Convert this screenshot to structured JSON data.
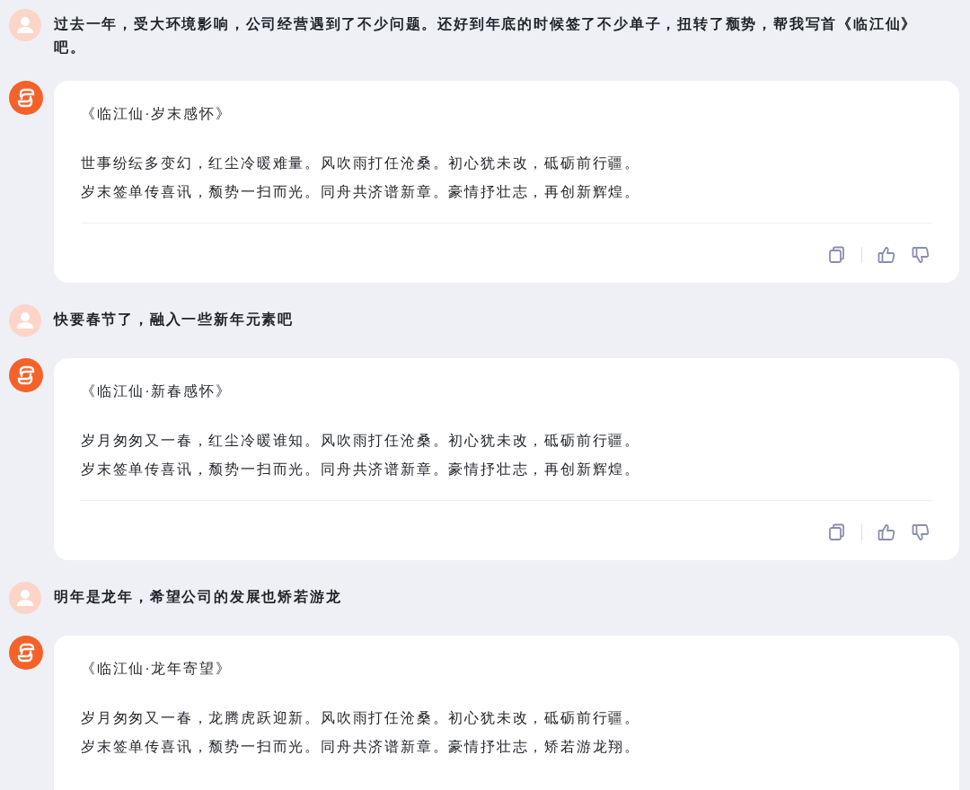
{
  "messages": [
    {
      "kind": "user",
      "text": "过去一年，受大环境影响，公司经营遇到了不少问题。还好到年底的时候签了不少单子，扭转了颓势，帮我写首《临江仙》吧。"
    },
    {
      "kind": "bot",
      "title": "《临江仙·岁末感怀》",
      "lines": [
        "世事纷纭多变幻，红尘冷暖难量。风吹雨打任沧桑。初心犹未改，砥砺前行疆。",
        "岁末签单传喜讯，颓势一扫而光。同舟共济谱新章。豪情抒壮志，再创新辉煌。"
      ],
      "actions": true
    },
    {
      "kind": "user",
      "text": "快要春节了，融入一些新年元素吧"
    },
    {
      "kind": "bot",
      "title": "《临江仙·新春感怀》",
      "lines": [
        "岁月匆匆又一春，红尘冷暖谁知。风吹雨打任沧桑。初心犹未改，砥砺前行疆。",
        "岁末签单传喜讯，颓势一扫而光。同舟共济谱新章。豪情抒壮志，再创新辉煌。"
      ],
      "actions": true
    },
    {
      "kind": "user",
      "text": "明年是龙年，希望公司的发展也矫若游龙"
    },
    {
      "kind": "bot",
      "title": "《临江仙·龙年寄望》",
      "lines": [
        "岁月匆匆又一春，龙腾虎跃迎新。风吹雨打任沧桑。初心犹未改，砥砺前行疆。",
        "岁末签单传喜讯，颓势一扫而光。同舟共济谱新章。豪情抒壮志，矫若游龙翔。"
      ],
      "actions": false
    }
  ]
}
